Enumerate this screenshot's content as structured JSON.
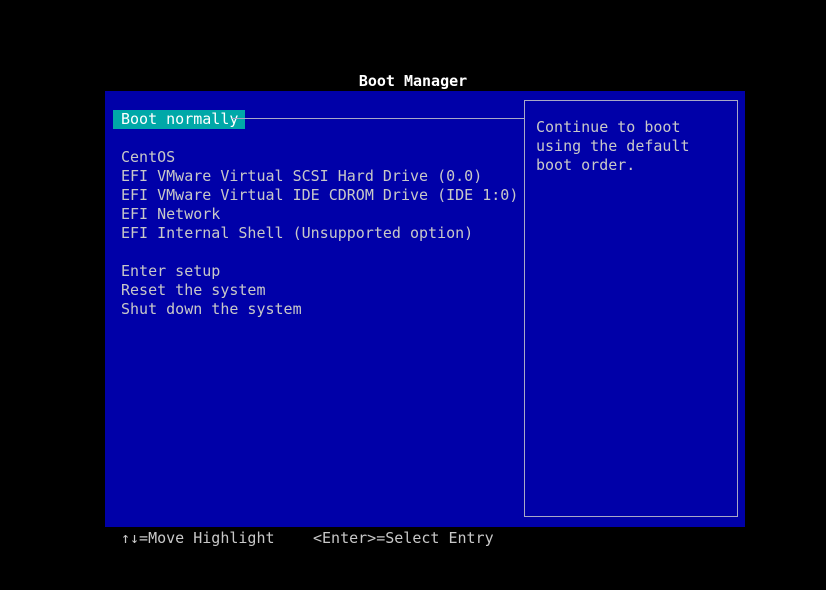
{
  "title": "Boot Manager",
  "menu": {
    "selected": "Boot normally",
    "boot_options": [
      "CentOS",
      "EFI VMware Virtual SCSI Hard Drive (0.0)",
      "EFI VMware Virtual IDE CDROM Drive (IDE 1:0)",
      "EFI Network",
      "EFI Internal Shell (Unsupported option)"
    ],
    "system_options": [
      "Enter setup",
      "Reset the system",
      "Shut down the system"
    ]
  },
  "help": {
    "text": "Continue to boot using the default boot order."
  },
  "footer": {
    "move_hint": "↑↓=Move Highlight",
    "select_hint": "<Enter>=Select Entry"
  },
  "colors": {
    "background": "#000000",
    "panel": "#0000a8",
    "highlight": "#00a8a8",
    "text": "#c8c8c8"
  }
}
